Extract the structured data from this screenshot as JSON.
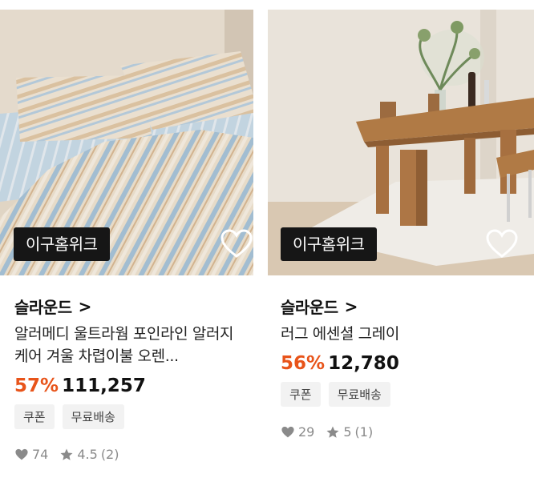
{
  "products": [
    {
      "badge": "이구홈위크",
      "brand": "슬라운드",
      "chevron": ">",
      "title": "알러메디 울트라웜 포인라인 알러지케어 겨울 차렵이불 오렌...",
      "discount": "57%",
      "price": "111,257",
      "tags": [
        "쿠폰",
        "무료배송"
      ],
      "likes": "74",
      "rating": "4.5",
      "reviews": "(2)",
      "image_icon": "striped-bedding-photo"
    },
    {
      "badge": "이구홈위크",
      "brand": "슬라운드",
      "chevron": ">",
      "title": "러그 에센셜 그레이",
      "discount": "56%",
      "price": "12,780",
      "tags": [
        "쿠폰",
        "무료배송"
      ],
      "likes": "29",
      "rating": "5",
      "reviews": "(1)",
      "image_icon": "dining-table-rug-photo"
    }
  ],
  "colors": {
    "discount": "#e8541a",
    "badge_bg": "#161616",
    "tag_bg": "#f2f2f2",
    "meta_gray": "#8a8a8a"
  }
}
